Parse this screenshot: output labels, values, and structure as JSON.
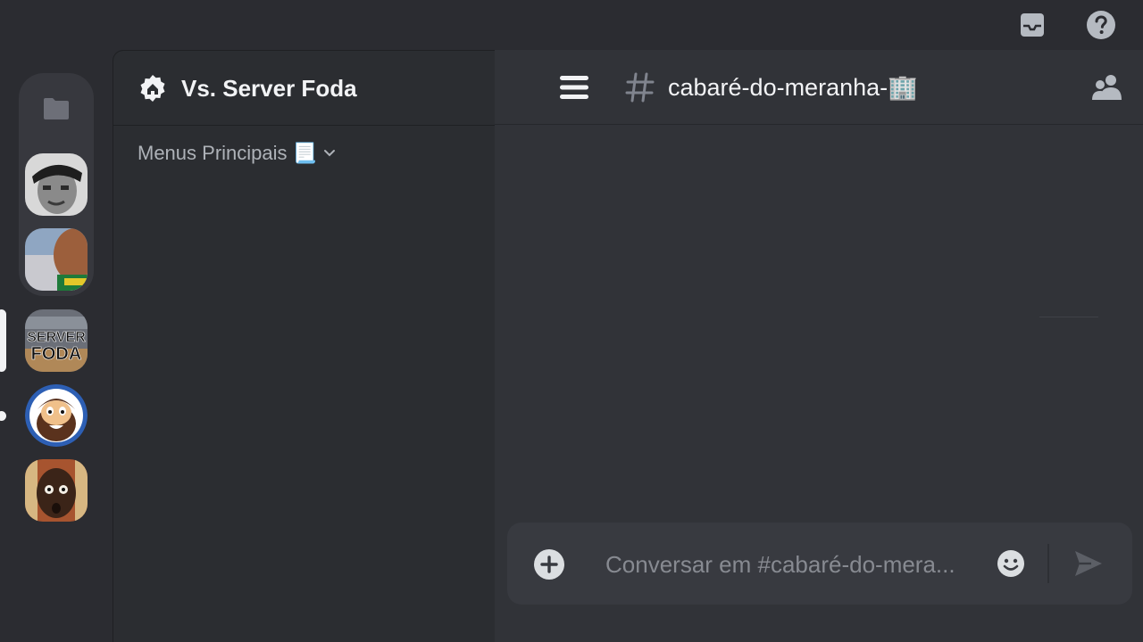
{
  "top_bar": {
    "inbox_icon": "inbox-icon",
    "help_icon": "help-icon"
  },
  "server_rail": {
    "folder_icon": "folder-icon",
    "servers": [
      {
        "name": "user-avatar-bw",
        "colors": [
          "#cfcfcf",
          "#2c2c2c"
        ]
      },
      {
        "name": "user-avatar-outdoor",
        "colors": [
          "#6f8cae",
          "#b47a55",
          "#2a8a3a"
        ]
      },
      {
        "name": "server-foda",
        "logo_text": "SERVER FODA",
        "active": true
      },
      {
        "name": "bearded-character",
        "unread": true
      },
      {
        "name": "surprised-face"
      }
    ]
  },
  "channel_panel": {
    "server_title": "Vs. Server Foda",
    "category": "Menus Principais 📃"
  },
  "chat": {
    "channel_name": "cabaré-do-meranha-🏢",
    "composer_placeholder": "Conversar em #cabaré-do-mera..."
  },
  "colors": {
    "rail_bg": "#2b2c31",
    "panel_bg": "#2b2d31",
    "chat_bg": "#313338",
    "composer_bg": "#383a40",
    "text_primary": "#f2f3f5",
    "text_muted": "#aeb2b8"
  }
}
